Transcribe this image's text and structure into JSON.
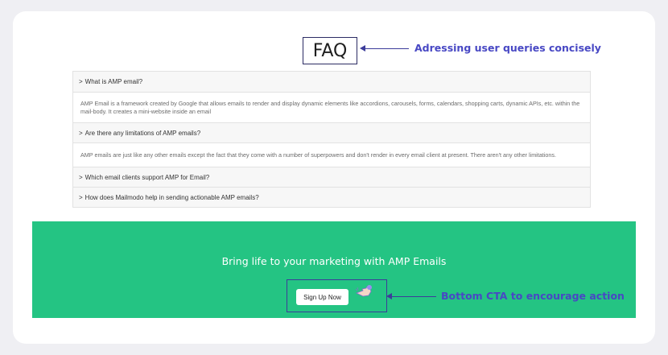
{
  "faq": {
    "title": "FAQ",
    "annotation": "Adressing user queries concisely",
    "items": [
      {
        "question": "What is AMP email?",
        "answer": "AMP Email is a framework created by Google that allows emails to render and display dynamic elements like accordions, carousels, forms, calendars, shopping carts, dynamic APIs, etc. within the mail-body. It creates a mini-website inside an email"
      },
      {
        "question": "Are there any limitations of AMP emails?",
        "answer": "AMP emails are just like any other emails except the fact that they come with a number of superpowers and don't render in every email client at present. There aren't any other limitations."
      },
      {
        "question": "Which email clients support AMP for Email?"
      },
      {
        "question": "How does Mailmodo help in sending actionable AMP emails?"
      }
    ],
    "chevron": ">"
  },
  "cta": {
    "heading": "Bring life to your marketing with AMP Emails",
    "button_label": "Sign Up Now",
    "annotation": "Bottom CTA to encourage action",
    "background_color": "#24c483",
    "pointer_icon": "pointing-hand-icon"
  },
  "annotation_color": "#4848c4"
}
